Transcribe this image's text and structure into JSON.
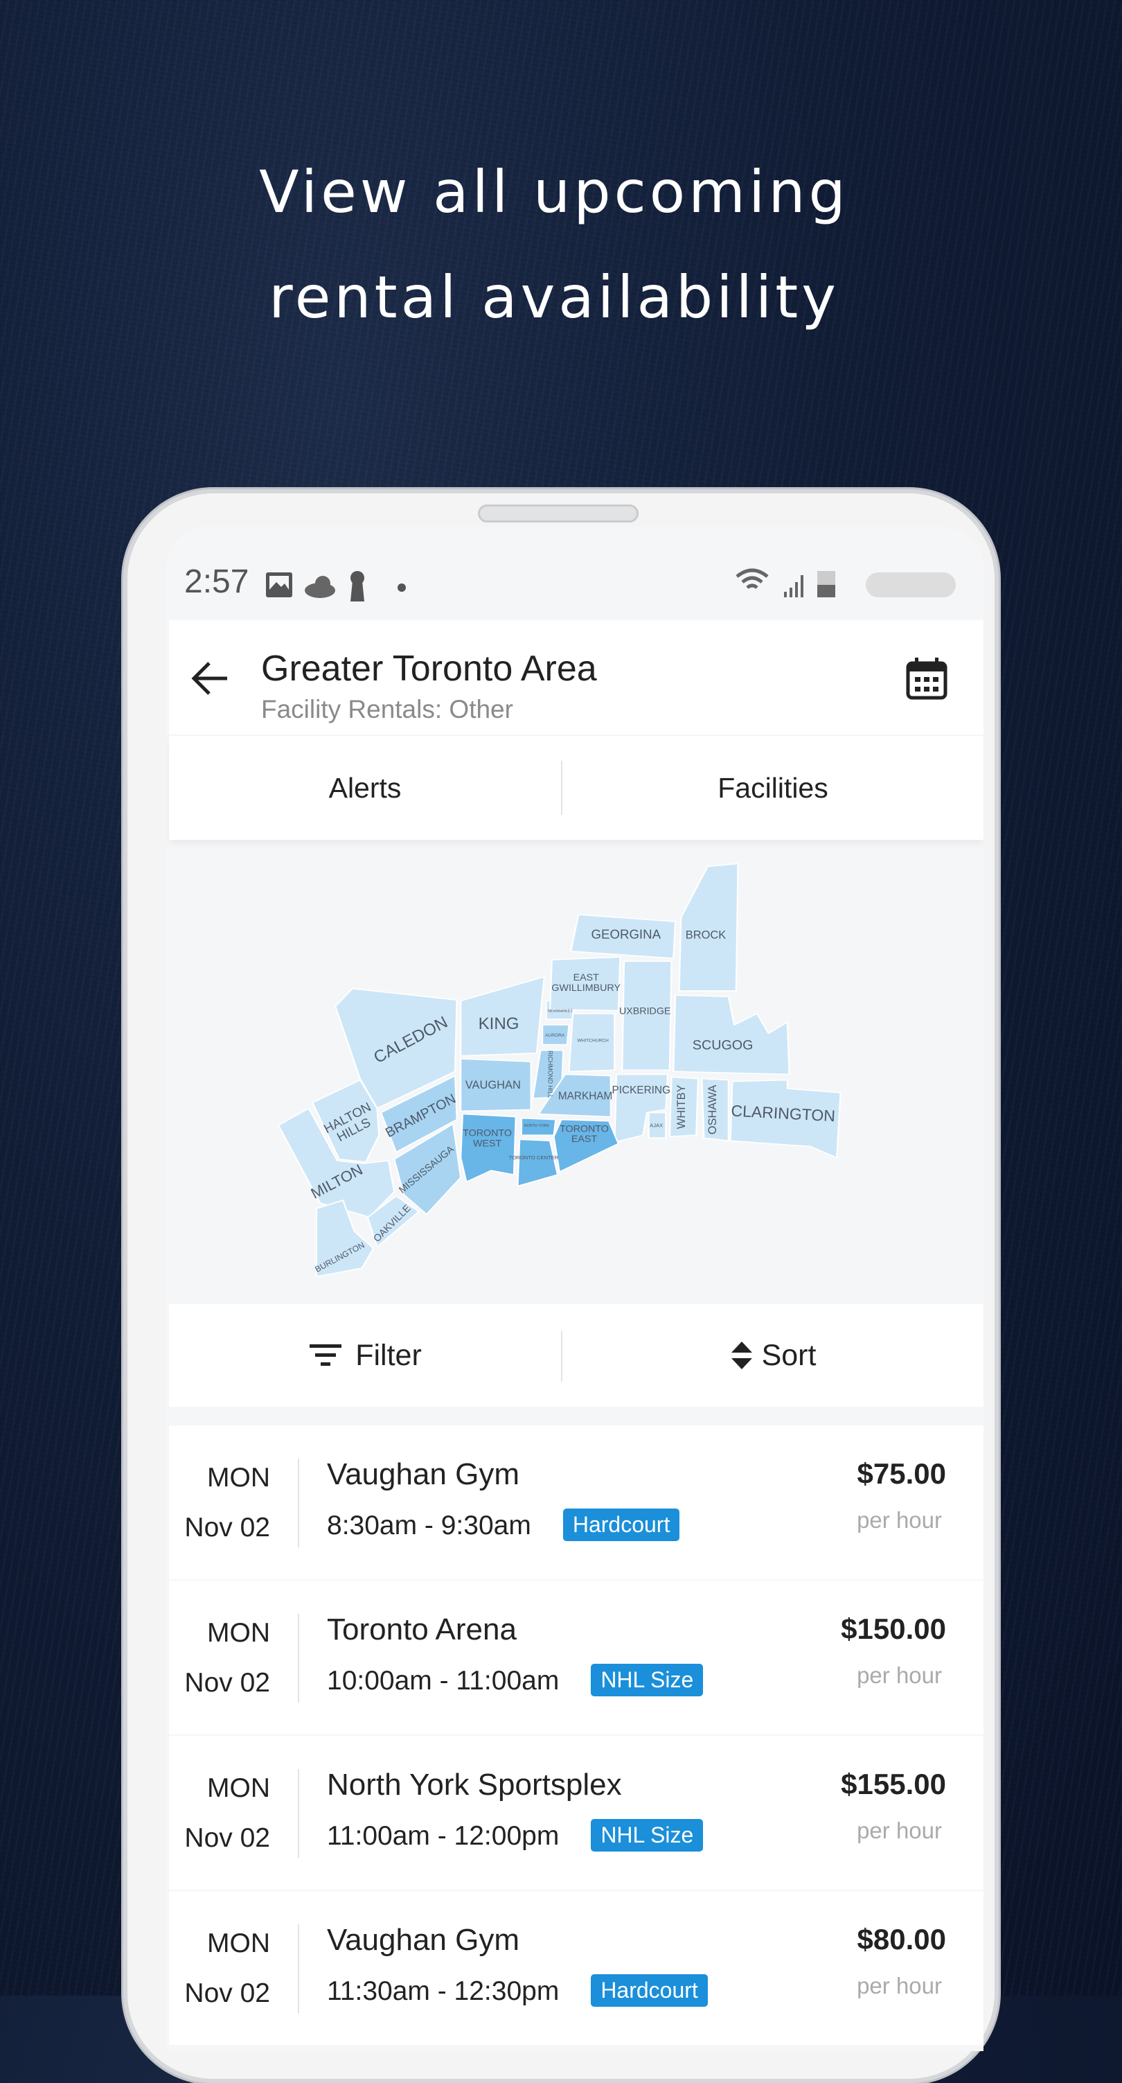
{
  "headline": {
    "line1": "View all upcoming",
    "line2": "rental availability"
  },
  "status_bar": {
    "time": "2:57",
    "icons": [
      "image-icon",
      "cloud-icon",
      "keyhole-icon",
      "dot-icon",
      "wifi-icon",
      "signal-icon",
      "battery-icon"
    ]
  },
  "header": {
    "title": "Greater Toronto Area",
    "subtitle": "Facility Rentals: Other",
    "back_icon": "arrow-left-icon",
    "calendar_icon": "calendar-icon"
  },
  "tabs": [
    {
      "label": "Alerts"
    },
    {
      "label": "Facilities"
    }
  ],
  "map": {
    "regions": {
      "caledon": "CALEDON",
      "halton_hills": "HALTON HILLS",
      "milton": "MILTON",
      "burlington": "BURLINGTON",
      "oakville": "OAKVILLE",
      "mississauga": "MISSISSAUGA",
      "brampton": "BRAMPTON",
      "king": "KING",
      "vaughan": "VAUGHAN",
      "newmarket": "NEWMARKET",
      "aurora": "AURORA",
      "richmond_hill": "RICHMOND HILL",
      "whitchurch": "WHITCHURCH",
      "east_gwillimbury": "EAST GWILLIMBURY",
      "georgina": "GEORGINA",
      "brock": "BROCK",
      "uxbridge": "UXBRIDGE",
      "scugog": "SCUGOG",
      "markham": "MARKHAM",
      "pickering": "PICKERING",
      "ajax": "AJAX",
      "whitby": "WHITBY",
      "oshawa": "OSHAWA",
      "clarington": "CLARINGTON",
      "toronto_west": "TORONTO WEST",
      "north_york": "NORTH YORK",
      "toronto_center": "TORONTO CENTER",
      "toronto_east": "TORONTO EAST"
    },
    "colors": {
      "light": "#cde6f7",
      "medium": "#a8d4f2",
      "dark": "#68b5e8"
    }
  },
  "toolbar": {
    "filter_label": "Filter",
    "sort_label": "Sort"
  },
  "listings": [
    {
      "day": "MON",
      "date": "Nov 02",
      "name": "Vaughan Gym",
      "time": "8:30am - 9:30am",
      "tag": "Hardcourt",
      "price": "$75.00",
      "unit": "per hour"
    },
    {
      "day": "MON",
      "date": "Nov 02",
      "name": "Toronto Arena",
      "time": "10:00am - 11:00am",
      "tag": "NHL Size",
      "price": "$150.00",
      "unit": "per hour"
    },
    {
      "day": "MON",
      "date": "Nov 02",
      "name": "North York Sportsplex",
      "time": "11:00am - 12:00pm",
      "tag": "NHL Size",
      "price": "$155.00",
      "unit": "per hour"
    },
    {
      "day": "MON",
      "date": "Nov 02",
      "name": "Vaughan Gym",
      "time": "11:30am - 12:30pm",
      "tag": "Hardcourt",
      "price": "$80.00",
      "unit": "per hour"
    }
  ],
  "colors": {
    "accent": "#1b8fd9",
    "background": "#111d36"
  }
}
